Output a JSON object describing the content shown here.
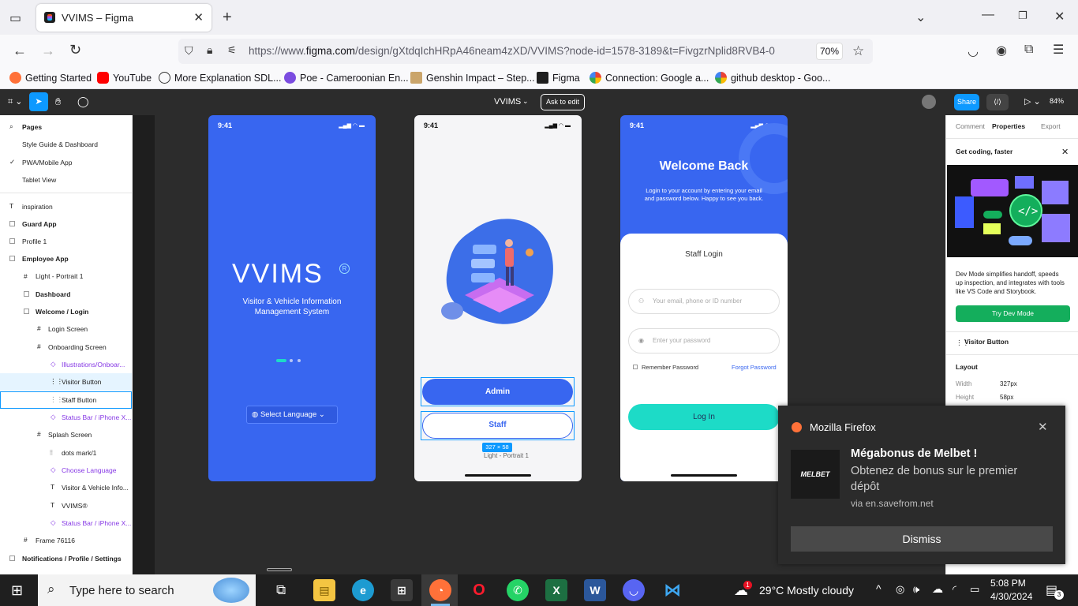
{
  "browser": {
    "tab_title": "VVIMS – Figma",
    "url_host_prefix": "https://www.",
    "url_host": "figma.com",
    "url_path": "/design/gXtdqIchHRpA46neam4zXD/VVIMS?node-id=1578-3189&t=FivgzrNplid8RVB4-0",
    "zoom": "70%",
    "bookmarks": [
      "Getting Started",
      "YouTube",
      "More Explanation SDL...",
      "Poe - Cameroonian En...",
      "Genshin Impact – Step...",
      "Figma",
      "Connection: Google a...",
      "github desktop - Goo..."
    ]
  },
  "figma_toolbar": {
    "file_name": "VVIMS",
    "ask_to_edit": "Ask to edit",
    "share": "Share",
    "zoom": "84%"
  },
  "left_panel": {
    "pages_label": "Pages",
    "pages": [
      "Style Guide & Dashboard",
      "PWA/Mobile App",
      "Tablet View"
    ],
    "layers": {
      "inspiration": "inspiration",
      "guard_app": "Guard App",
      "profile_1": "Profile 1",
      "employee_app": "Employee App",
      "light_portrait": "Light - Portrait 1",
      "dashboard": "Dashboard",
      "welcome_login": "Welcome / Login",
      "login_screen": "Login Screen",
      "onboarding_screen": "Onboarding Screen",
      "illustrations": "Illustrations/Onboar...",
      "visitor_button": "Visitor Button",
      "staff_button": "Staff Button",
      "status_bar_1": "Status Bar / iPhone X...",
      "splash_screen": "Splash Screen",
      "dots_mark": "dots mark/1",
      "choose_language": "Choose Language",
      "visitor_vehicle_info": "Visitor & Vehicle Info...",
      "vvims_text": "VVIMS®",
      "status_bar_2": "Status Bar / iPhone X...",
      "frame_76116": "Frame 76116",
      "notifications": "Notifications / Profile / Settings"
    }
  },
  "canvas": {
    "time": "9:41",
    "splash": {
      "logo": "VVIMS",
      "registered": "R",
      "subtitle_1": "Visitor & Vehicle Information",
      "subtitle_2": "Management System",
      "select_language": "Select Language"
    },
    "onboarding": {
      "admin_button": "Admin",
      "staff_button": "Staff",
      "size_chip": "327 × 58",
      "frame_label": "Light - Portrait 1"
    },
    "welcome": {
      "title": "Welcome Back",
      "subtitle_1": "Login to your account by entering your email",
      "subtitle_2": "and password  below. Happy to see you back.",
      "card_title": "Staff Login",
      "email_placeholder": "Your email, phone or ID number",
      "password_placeholder": "Enter your password",
      "remember": "Remember Password",
      "forgot": "Forgot Password",
      "login_button": "Log In"
    }
  },
  "right_panel": {
    "tabs": [
      "Comment",
      "Properties",
      "Export"
    ],
    "promo_title": "Get coding, faster",
    "promo_text_1": "Dev Mode simplifies handoff, speeds",
    "promo_text_2": "up inspection, and integrates with tools",
    "promo_text_3": "like VS Code and Storybook.",
    "try_dev_mode": "Try Dev Mode",
    "selected_layer": "Visitor Button",
    "layout_label": "Layout",
    "width_label": "Width",
    "width_value": "327px",
    "height_label": "Height",
    "height_value": "58px"
  },
  "notification": {
    "app": "Mozilla Firefox",
    "title": "Mégabonus de Melbet !",
    "body_1": "Obtenez  de bonus sur le premier",
    "body_2": "dépôt",
    "via": "via en.savefrom.net",
    "dismiss": "Dismiss",
    "logo_text": "MELBET"
  },
  "taskbar": {
    "search_placeholder": "Type here to search",
    "weather": "29°C  Mostly cloudy",
    "weather_badge": "1",
    "time": "5:08 PM",
    "date": "4/30/2024",
    "notif_count": "3"
  },
  "colors": {
    "figma_blue": "#0d99ff",
    "app_blue": "#3866f0",
    "teal": "#1ddbc7",
    "dev_green": "#14ae5c"
  }
}
